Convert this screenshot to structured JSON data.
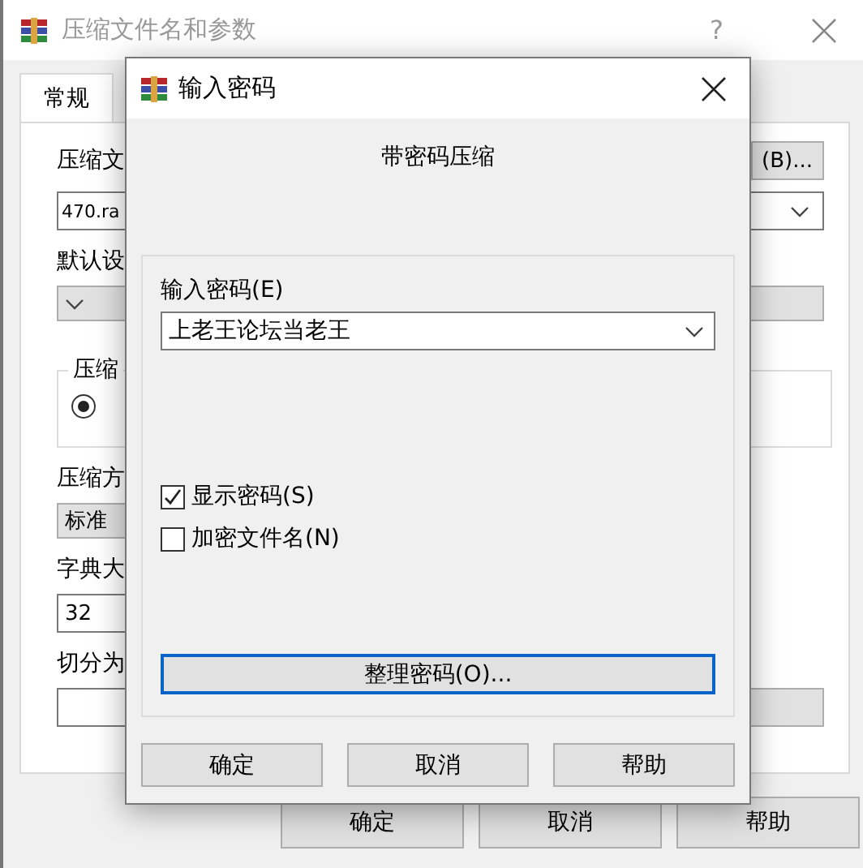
{
  "main_window": {
    "title": "压缩文件名和参数",
    "help": "?",
    "tabs": [
      {
        "label": "常规",
        "selected": true
      }
    ],
    "archive_name_label": "压缩文",
    "browse_button": "(B)...",
    "archive_name": "470.ra",
    "default_label": "默认设",
    "method_group_label": "压缩",
    "method_radios": [
      {
        "selected": true
      }
    ],
    "compression_label": "压缩方",
    "compression_value": "标准",
    "dictionary_label": "字典大",
    "dictionary_value": "32",
    "split_label": "切分为",
    "buttons": [
      "确定",
      "取消",
      "帮助"
    ]
  },
  "password_dialog": {
    "title": "输入密码",
    "heading": "带密码压缩",
    "password_label": "输入密码(E)",
    "password_value": "上老王论坛当老王",
    "options": [
      {
        "label": "显示密码(S)",
        "checked": true
      },
      {
        "label": "加密文件名(N)",
        "checked": false
      }
    ],
    "organize_button": {
      "label": "整理密码(O)...",
      "focused": true
    },
    "buttons": [
      "确定",
      "取消",
      "帮助"
    ]
  }
}
